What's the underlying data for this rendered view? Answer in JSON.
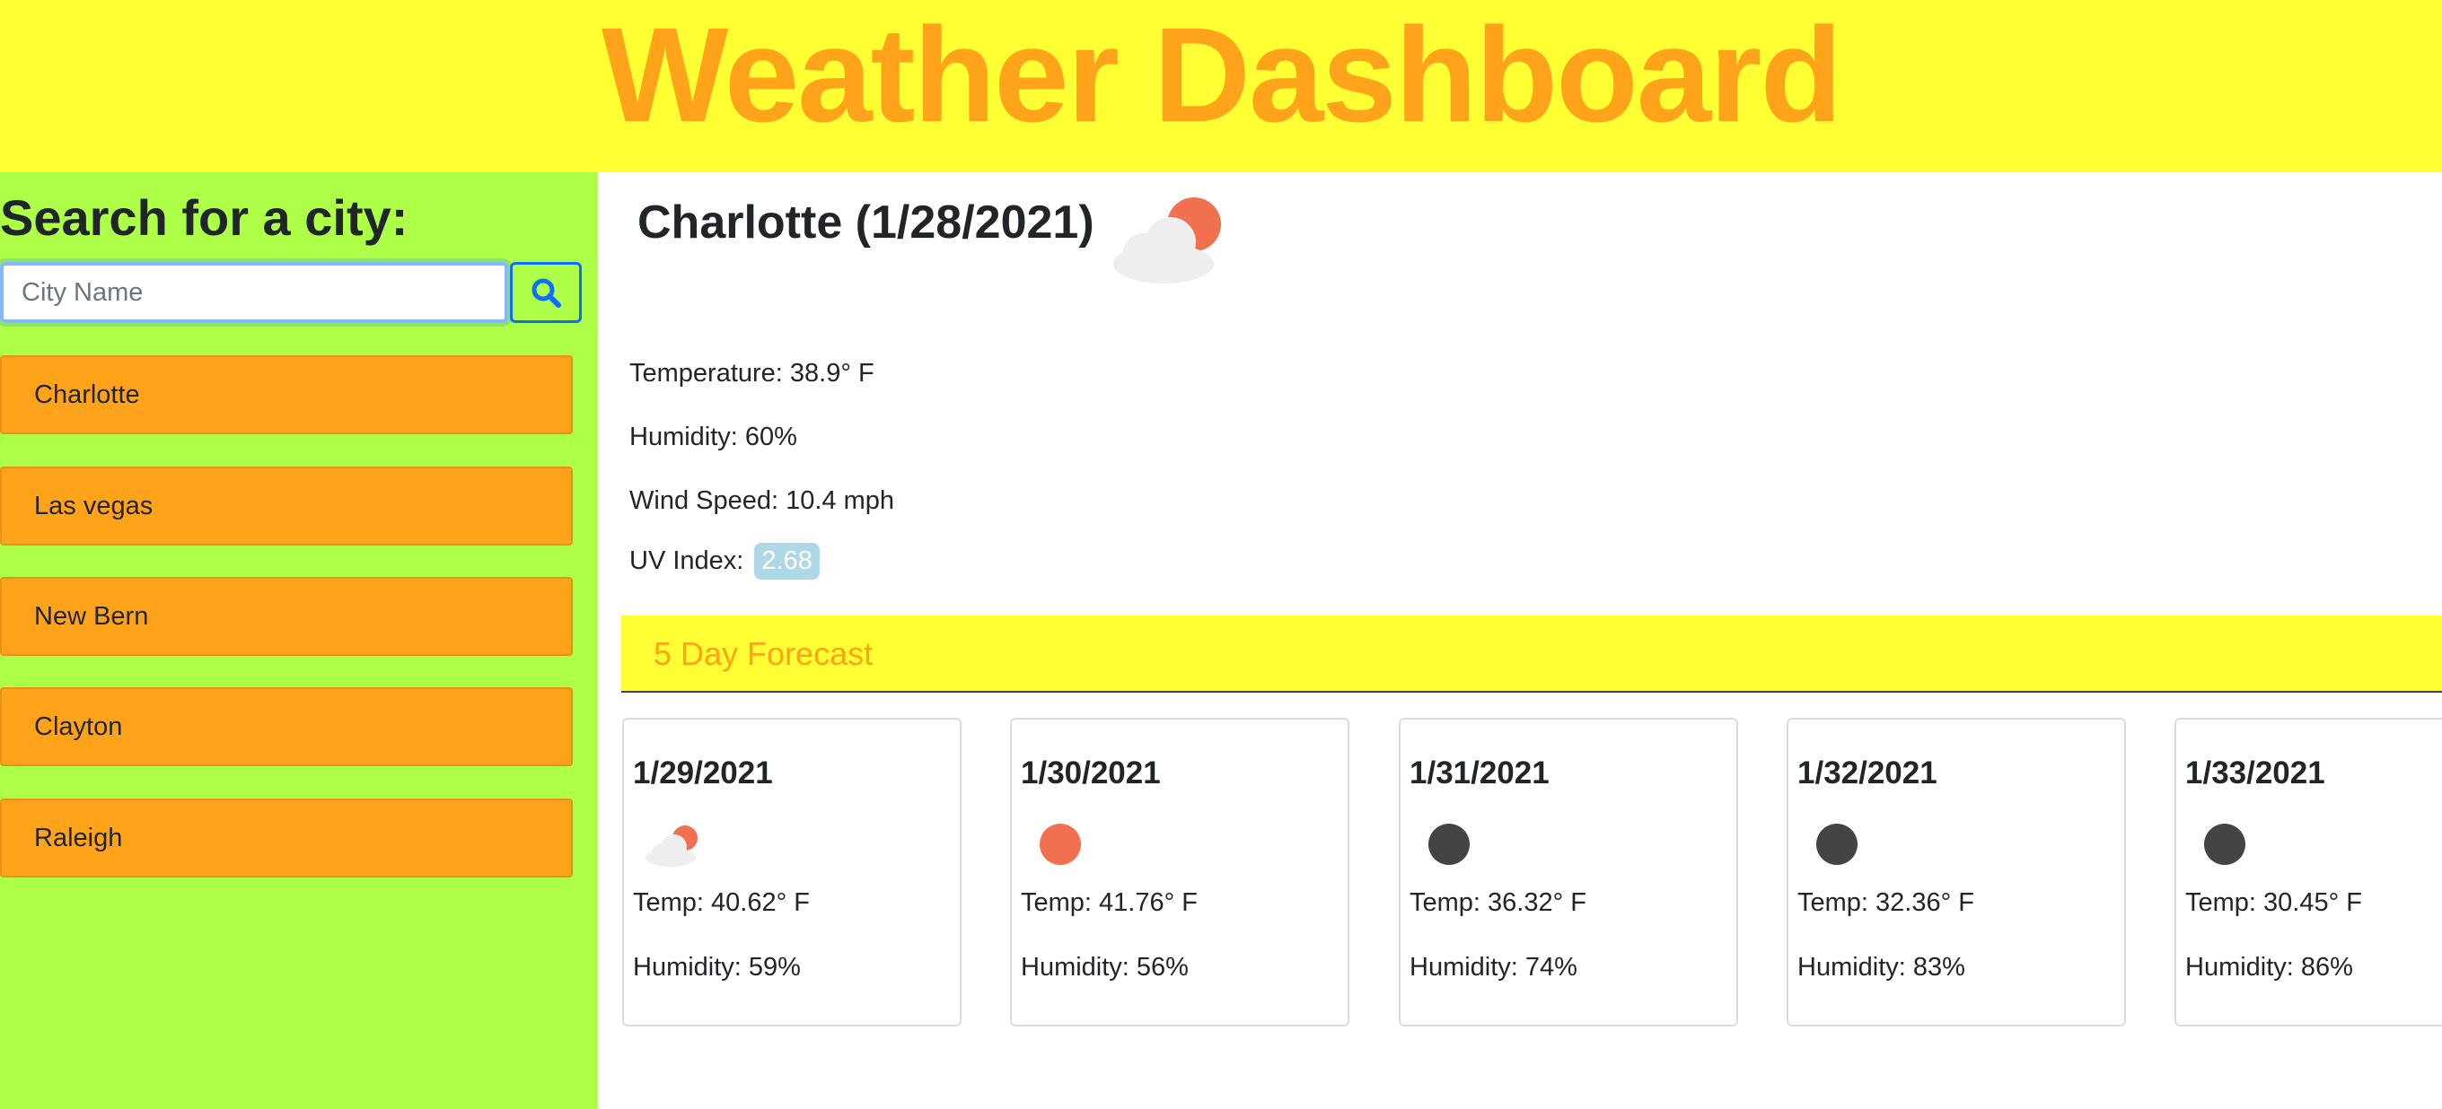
{
  "header": {
    "title": "Weather Dashboard"
  },
  "sidebar": {
    "heading": "Search for a city:",
    "search": {
      "placeholder": "City Name",
      "value": ""
    },
    "search_icon": "search-icon",
    "history": [
      "Charlotte",
      "Las vegas",
      "New Bern",
      "Clayton",
      "Raleigh"
    ]
  },
  "current": {
    "title": "Charlotte (1/28/2021)",
    "icon": "partly-cloudy-icon",
    "temperature": "Temperature: 38.9° F",
    "humidity": "Humidity: 60%",
    "wind": "Wind Speed: 10.4 mph",
    "uv_label": "UV Index:",
    "uv_value": "2.68"
  },
  "forecast": {
    "heading": "5 Day Forecast",
    "days": [
      {
        "date": "1/29/2021",
        "icon": "partly-cloudy-icon",
        "temp": "Temp: 40.62° F",
        "humidity": "Humidity: 59%"
      },
      {
        "date": "1/30/2021",
        "icon": "sun-icon",
        "temp": "Temp: 41.76° F",
        "humidity": "Humidity: 56%"
      },
      {
        "date": "1/31/2021",
        "icon": "moon-icon",
        "temp": "Temp: 36.32° F",
        "humidity": "Humidity: 74%"
      },
      {
        "date": "1/32/2021",
        "icon": "moon-icon",
        "temp": "Temp: 32.36° F",
        "humidity": "Humidity: 83%"
      },
      {
        "date": "1/33/2021",
        "icon": "moon-icon",
        "temp": "Temp: 30.45° F",
        "humidity": "Humidity: 86%"
      }
    ]
  },
  "colors": {
    "header_bg": "#ffff33",
    "accent_orange": "#ffa31a",
    "sidebar_bg": "#adff47",
    "sun": "#f07050",
    "cloud": "#eeeeee",
    "night": "#444444",
    "uv_badge": "#add8e6",
    "search_blue": "#0d6efd"
  }
}
